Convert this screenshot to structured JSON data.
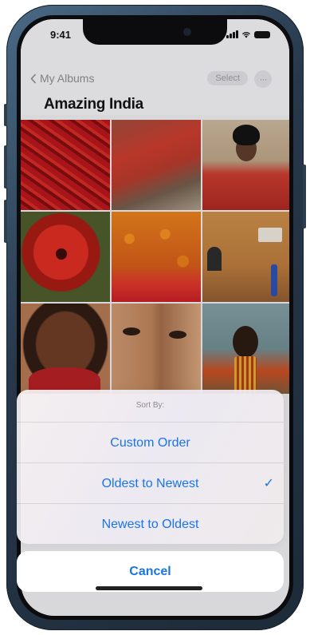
{
  "status_bar": {
    "time": "9:41"
  },
  "nav": {
    "back_label": "My Albums",
    "select_label": "Select",
    "more_label": "···"
  },
  "album": {
    "title": "Amazing India"
  },
  "photos": [
    {
      "subject": "red chilies"
    },
    {
      "subject": "feet in red sari"
    },
    {
      "subject": "woman in red"
    },
    {
      "subject": "red poppy flower"
    },
    {
      "subject": "oranges in crates"
    },
    {
      "subject": "person by yellow wall"
    },
    {
      "subject": "woman with curly hair"
    },
    {
      "subject": "close-up faces"
    },
    {
      "subject": "woman in striped dress"
    }
  ],
  "sort_sheet": {
    "title": "Sort By:",
    "options": [
      {
        "label": "Custom Order",
        "selected": false
      },
      {
        "label": "Oldest to Newest",
        "selected": true
      },
      {
        "label": "Newest to Oldest",
        "selected": false
      }
    ],
    "checkmark": "✓",
    "cancel_label": "Cancel"
  },
  "colors": {
    "accent": "#1a74e8",
    "frame": "#27384a"
  }
}
